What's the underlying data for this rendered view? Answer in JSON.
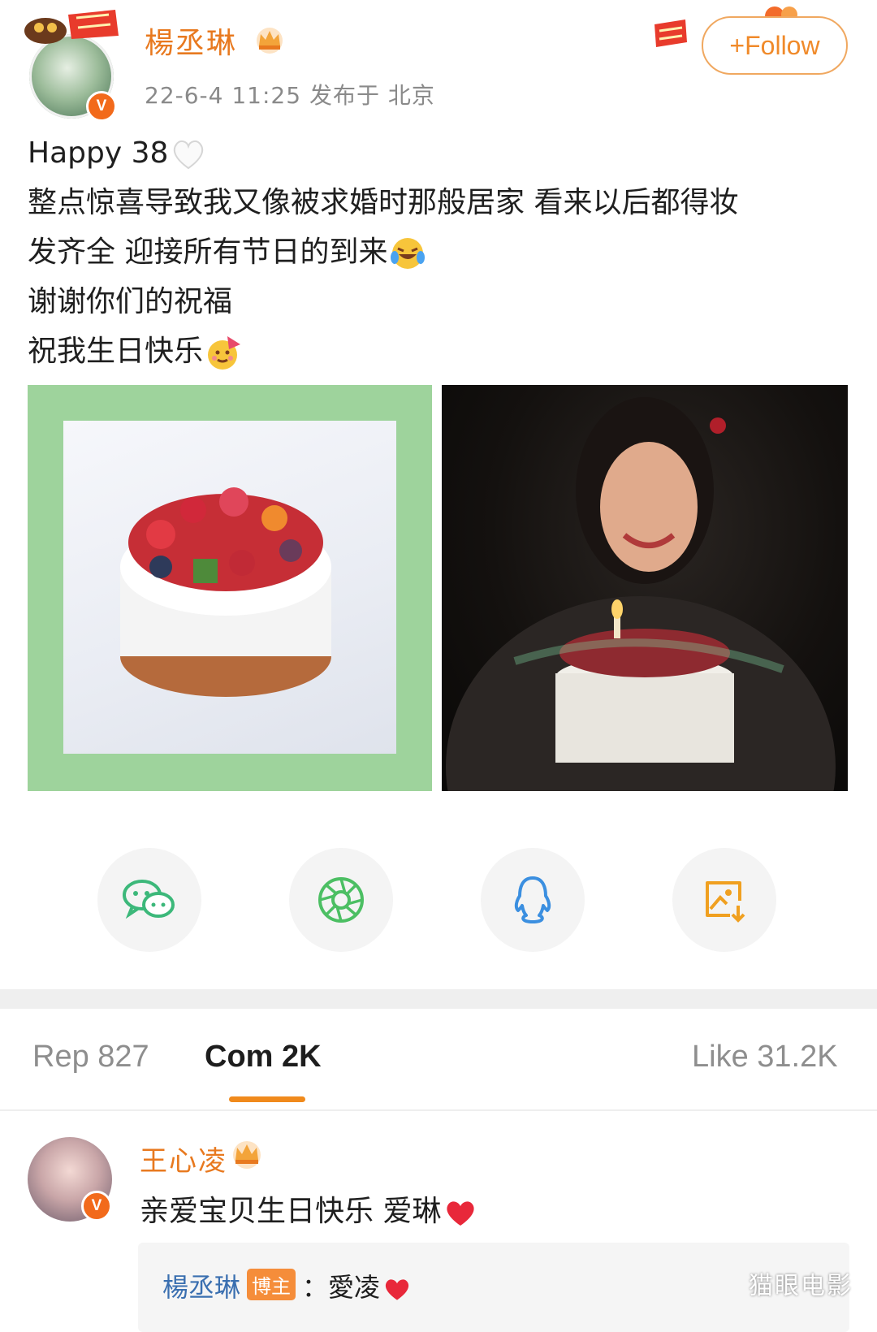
{
  "post": {
    "author": "楊丞琳",
    "meta": "22-6-4 11:25  发布于 北京",
    "follow_label": "+Follow",
    "lines": [
      "Happy 38",
      "整点惊喜导致我又像被求婚时那般居家 看来以后都得妆",
      "发齐全 迎接所有节日的到来",
      "谢谢你们的祝福",
      "祝我生日快乐"
    ]
  },
  "share": {
    "icons": [
      "wechat-icon",
      "moments-icon",
      "qq-icon",
      "save-image-icon"
    ]
  },
  "tabs": {
    "repost": "Rep 827",
    "comment": "Com 2K",
    "like": "Like 31.2K"
  },
  "comment": {
    "name": "王心凌",
    "text": "亲爱宝贝生日快乐 爱琳",
    "reply": {
      "name": "楊丞琳",
      "badge": "博主",
      "separator": "：",
      "text": "愛凌"
    }
  },
  "watermark": "猫眼电影",
  "colors": {
    "accent": "#e8791f",
    "link": "#3a6fb0",
    "image_frame": "#9ed39c"
  }
}
